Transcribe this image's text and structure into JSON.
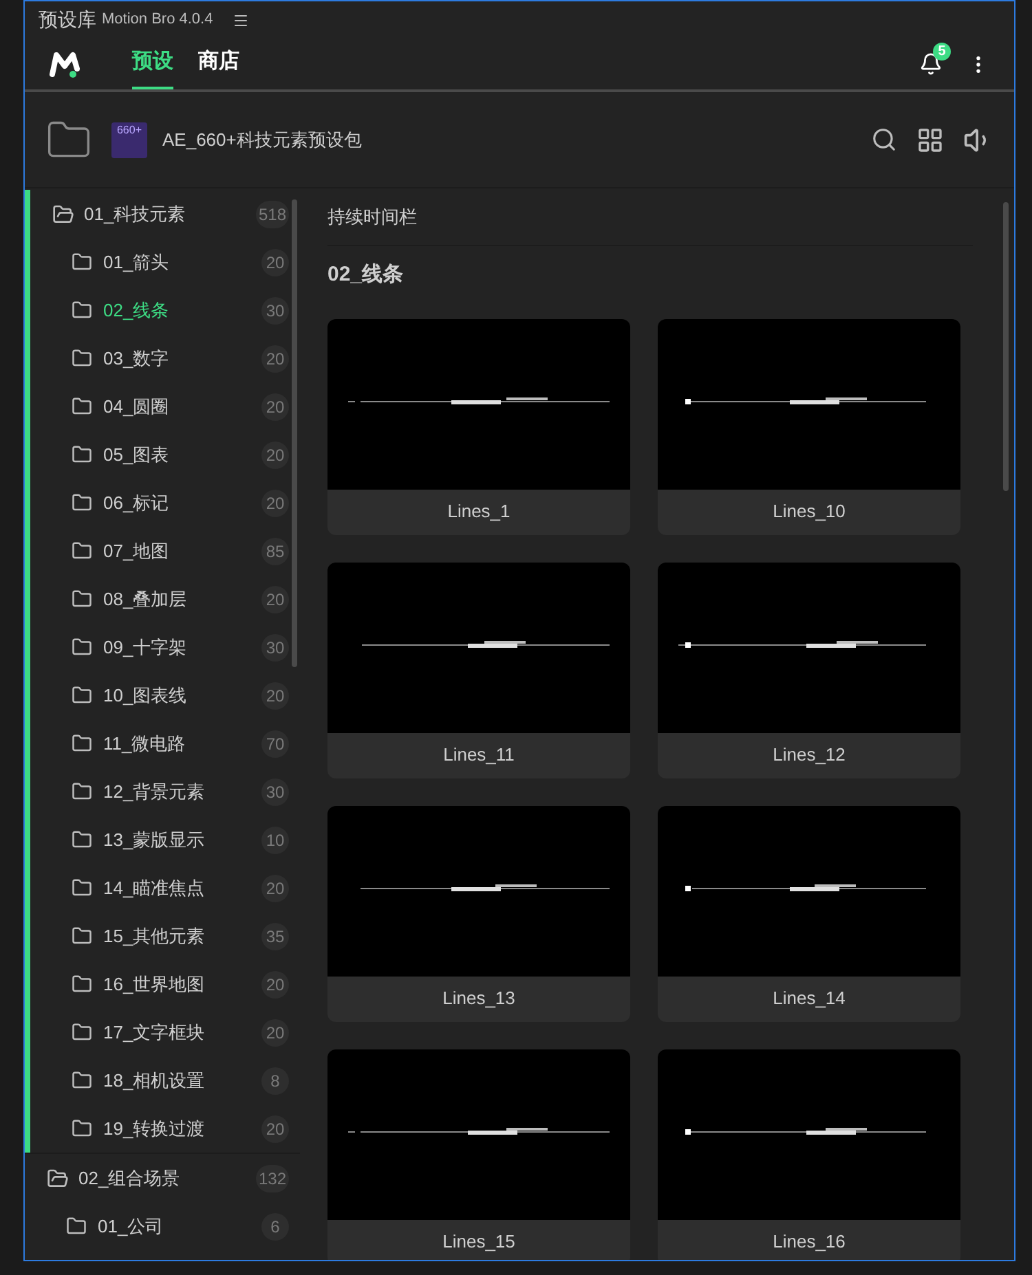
{
  "window": {
    "title": "预设库",
    "app_version": "Motion Bro 4.0.4"
  },
  "nav": {
    "tabs": [
      {
        "label": "预设",
        "selected": true
      },
      {
        "label": "商店",
        "selected": false
      }
    ],
    "notification_count": "5"
  },
  "pack": {
    "name": "AE_660+科技元素预设包",
    "cover_text": "660+"
  },
  "tree": [
    {
      "label": "01_科技元素",
      "count": "518",
      "expanded": true,
      "children": [
        {
          "label": "01_箭头",
          "count": "20",
          "selected": false
        },
        {
          "label": "02_线条",
          "count": "30",
          "selected": true
        },
        {
          "label": "03_数字",
          "count": "20",
          "selected": false
        },
        {
          "label": "04_圆圈",
          "count": "20",
          "selected": false
        },
        {
          "label": "05_图表",
          "count": "20",
          "selected": false
        },
        {
          "label": "06_标记",
          "count": "20",
          "selected": false
        },
        {
          "label": "07_地图",
          "count": "85",
          "selected": false
        },
        {
          "label": "08_叠加层",
          "count": "20",
          "selected": false
        },
        {
          "label": "09_十字架",
          "count": "30",
          "selected": false
        },
        {
          "label": "10_图表线",
          "count": "20",
          "selected": false
        },
        {
          "label": "11_微电路",
          "count": "70",
          "selected": false
        },
        {
          "label": "12_背景元素",
          "count": "30",
          "selected": false
        },
        {
          "label": "13_蒙版显示",
          "count": "10",
          "selected": false
        },
        {
          "label": "14_瞄准焦点",
          "count": "20",
          "selected": false
        },
        {
          "label": "15_其他元素",
          "count": "35",
          "selected": false
        },
        {
          "label": "16_世界地图",
          "count": "20",
          "selected": false
        },
        {
          "label": "17_文字框块",
          "count": "20",
          "selected": false
        },
        {
          "label": "18_相机设置",
          "count": "8",
          "selected": false
        },
        {
          "label": "19_转换过渡",
          "count": "20",
          "selected": false
        }
      ]
    },
    {
      "label": "02_组合场景",
      "count": "132",
      "expanded": true,
      "children": [
        {
          "label": "01_公司",
          "count": "6",
          "selected": false
        }
      ]
    }
  ],
  "content": {
    "duration_bar": "持续时间栏",
    "section_title": "02_线条",
    "presets": [
      "Lines_1",
      "Lines_10",
      "Lines_11",
      "Lines_12",
      "Lines_13",
      "Lines_14",
      "Lines_15",
      "Lines_16"
    ]
  }
}
